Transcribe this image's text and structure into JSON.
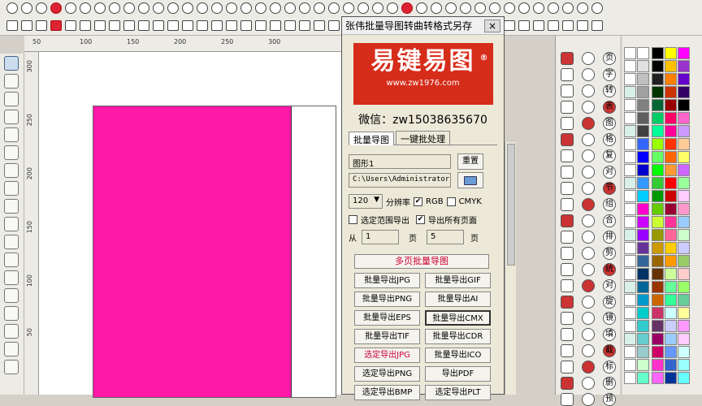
{
  "dialog": {
    "title": "张伟批量导图转曲转格式另存",
    "close": "×",
    "logo_text": "易键易图",
    "logo_reg": "®",
    "logo_url": "www.zw1976.com",
    "wechat": "微信：zw15038635670",
    "tabs": [
      "批量导图",
      "一键批处理"
    ],
    "name_value": "图形1",
    "reset_label": "重置",
    "path_value": "C:\\Users\\Administrator",
    "dpi_value": "120",
    "dpi_label": "分辨率",
    "rgb_label": "RGB",
    "cmyk_label": "CMYK",
    "range_label": "选定范围导出",
    "allpages_label": "导出所有页面",
    "from_label": "从",
    "from_value": "1",
    "page_label_1": "页",
    "to_value": "5",
    "page_label_2": "页",
    "multipage_label": "多页批量导图",
    "export_buttons": [
      "批量导出JPG",
      "批量导出GIF",
      "批量导出PNG",
      "批量导出AI",
      "批量导出EPS",
      "批量导出CMX",
      "批量导出TIF",
      "批量导出CDR",
      "选定导出JPG",
      "批量导出ICO",
      "选定导出PNG",
      "导出PDF",
      "选定导出BMP",
      "选定导出PLT"
    ]
  },
  "ruler": {
    "top_ticks": [
      "50",
      "100",
      "150",
      "200",
      "250",
      "300"
    ],
    "left_ticks": [
      "300",
      "250",
      "200",
      "150",
      "100",
      "50"
    ]
  },
  "colors": {
    "shape_fill": "#ff19a8",
    "logo_bg": "#d62c1a",
    "accent_red": "#cc0033"
  },
  "right_icon_chars": [
    "页",
    "字",
    "转",
    "表",
    "图",
    "格",
    "复",
    "对",
    "节",
    "组",
    "合",
    "排",
    "剪",
    "统",
    "对",
    "旋",
    "镜",
    "填",
    "截",
    "标",
    "删",
    "预"
  ],
  "palette": [
    [
      "#ffffff",
      "#ffffff",
      "#000000",
      "#ffff00",
      "#ff00ff"
    ],
    [
      "#ffffff",
      "#e0e0e0",
      "#000000",
      "#ffc000",
      "#9933cc"
    ],
    [
      "#ffffff",
      "#c0c0c0",
      "#202020",
      "#ff8000",
      "#6600cc"
    ],
    [
      "#d8f0e8",
      "#a0a0a0",
      "#003300",
      "#cc3300",
      "#330066"
    ],
    [
      "#ffffff",
      "#808080",
      "#006633",
      "#990000",
      "#000000"
    ],
    [
      "#ffffff",
      "#606060",
      "#00cc66",
      "#ff0066",
      "#ff66cc"
    ],
    [
      "#d8f0e8",
      "#404040",
      "#00ff99",
      "#ff0099",
      "#cc99ff"
    ],
    [
      "#ffffff",
      "#3366ff",
      "#99ff00",
      "#ff3300",
      "#ffcc99"
    ],
    [
      "#ffffff",
      "#0000ff",
      "#66ff66",
      "#ff6600",
      "#ffff66"
    ],
    [
      "#ffffff",
      "#0000cc",
      "#00ff00",
      "#ff9933",
      "#cc66ff"
    ],
    [
      "#d8f0e8",
      "#3399ff",
      "#33cc33",
      "#ff0000",
      "#99ff99"
    ],
    [
      "#ffffff",
      "#00ccff",
      "#009900",
      "#cc0000",
      "#ffccff"
    ],
    [
      "#ffffff",
      "#ff00cc",
      "#66cc00",
      "#990033",
      "#ff99cc"
    ],
    [
      "#ffffff",
      "#cc00ff",
      "#ccff33",
      "#ff3399",
      "#99ccff"
    ],
    [
      "#d8f0e8",
      "#9900ff",
      "#999900",
      "#ff6699",
      "#ccffcc"
    ],
    [
      "#ffffff",
      "#663399",
      "#cc9900",
      "#ffcc00",
      "#ccccff"
    ],
    [
      "#ffffff",
      "#336699",
      "#996600",
      "#ff9900",
      "#99cc66"
    ],
    [
      "#ffffff",
      "#003366",
      "#663300",
      "#ccff99",
      "#ffcccc"
    ],
    [
      "#d8f0e8",
      "#006699",
      "#993300",
      "#66ff99",
      "#99ff66"
    ],
    [
      "#ffffff",
      "#0099cc",
      "#cc6600",
      "#33ff99",
      "#66cc99"
    ],
    [
      "#ffffff",
      "#00cccc",
      "#cc3366",
      "#ccffff",
      "#ffff99"
    ],
    [
      "#ffffff",
      "#33cccc",
      "#663366",
      "#ccccff",
      "#ff99ff"
    ],
    [
      "#d8f0e8",
      "#66cccc",
      "#990066",
      "#99ccff",
      "#ffccff"
    ],
    [
      "#ffffff",
      "#99cccc",
      "#cc0066",
      "#6699ff",
      "#ccffff"
    ],
    [
      "#ffffff",
      "#ccffcc",
      "#ff33cc",
      "#3366cc",
      "#99ffff"
    ],
    [
      "#ffffff",
      "#66ffcc",
      "#ff66ff",
      "#003399",
      "#66ffff"
    ]
  ]
}
